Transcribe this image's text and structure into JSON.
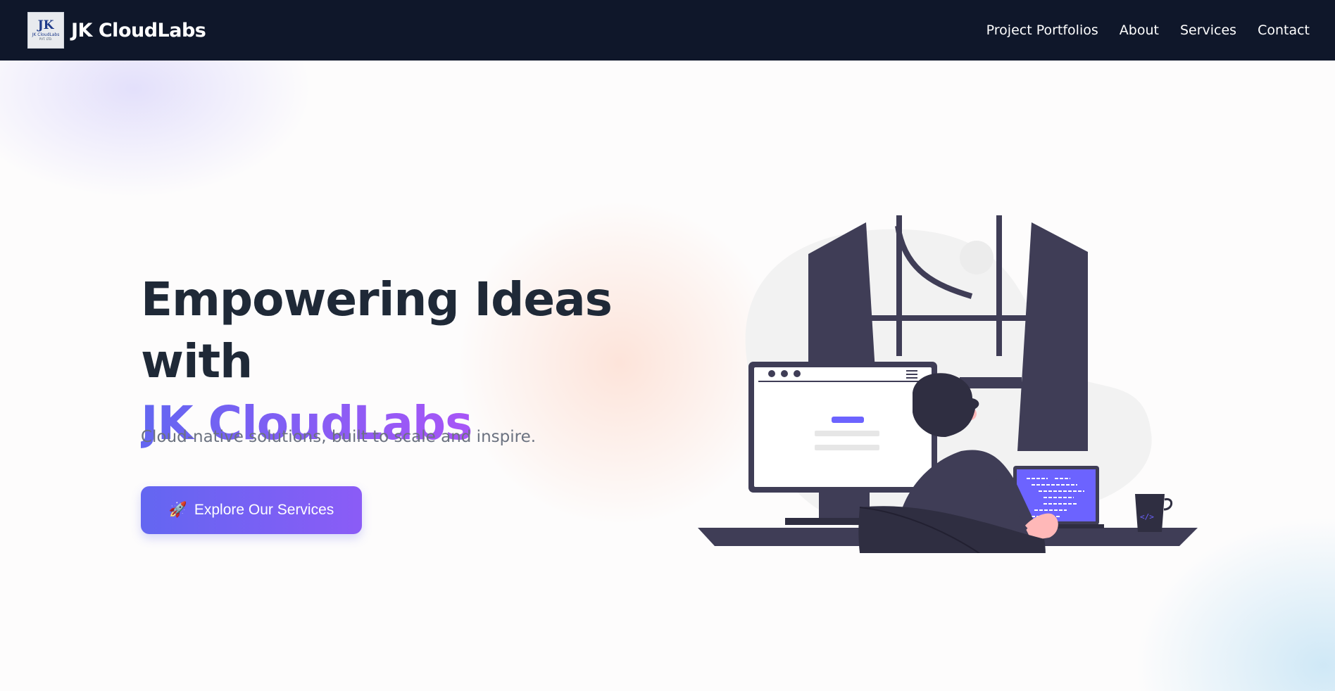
{
  "navbar": {
    "brand_name": "JK CloudLabs",
    "logo": {
      "mark": "JK",
      "line1": "JK CloudLabs",
      "line2": "PVT. LTD."
    },
    "links": [
      "Project Portfolios",
      "About",
      "Services",
      "Contact"
    ]
  },
  "hero": {
    "headline_line1": "Empowering Ideas with",
    "headline_line2": "JK CloudLabs",
    "subtitle": "Cloud-native solutions, built to scale and inspire.",
    "cta": {
      "icon": "🚀",
      "label": "Explore Our Services"
    }
  },
  "illustration": {
    "name": "developer-at-desk-illustration",
    "accent_color": "#6c63ff",
    "dark_color": "#3f3d56"
  },
  "colors": {
    "nav_bg": "#0f172a",
    "headline": "#1f2937",
    "gradient_start": "#6366f1",
    "gradient_end": "#a855f7",
    "subtitle": "#6b7280"
  }
}
